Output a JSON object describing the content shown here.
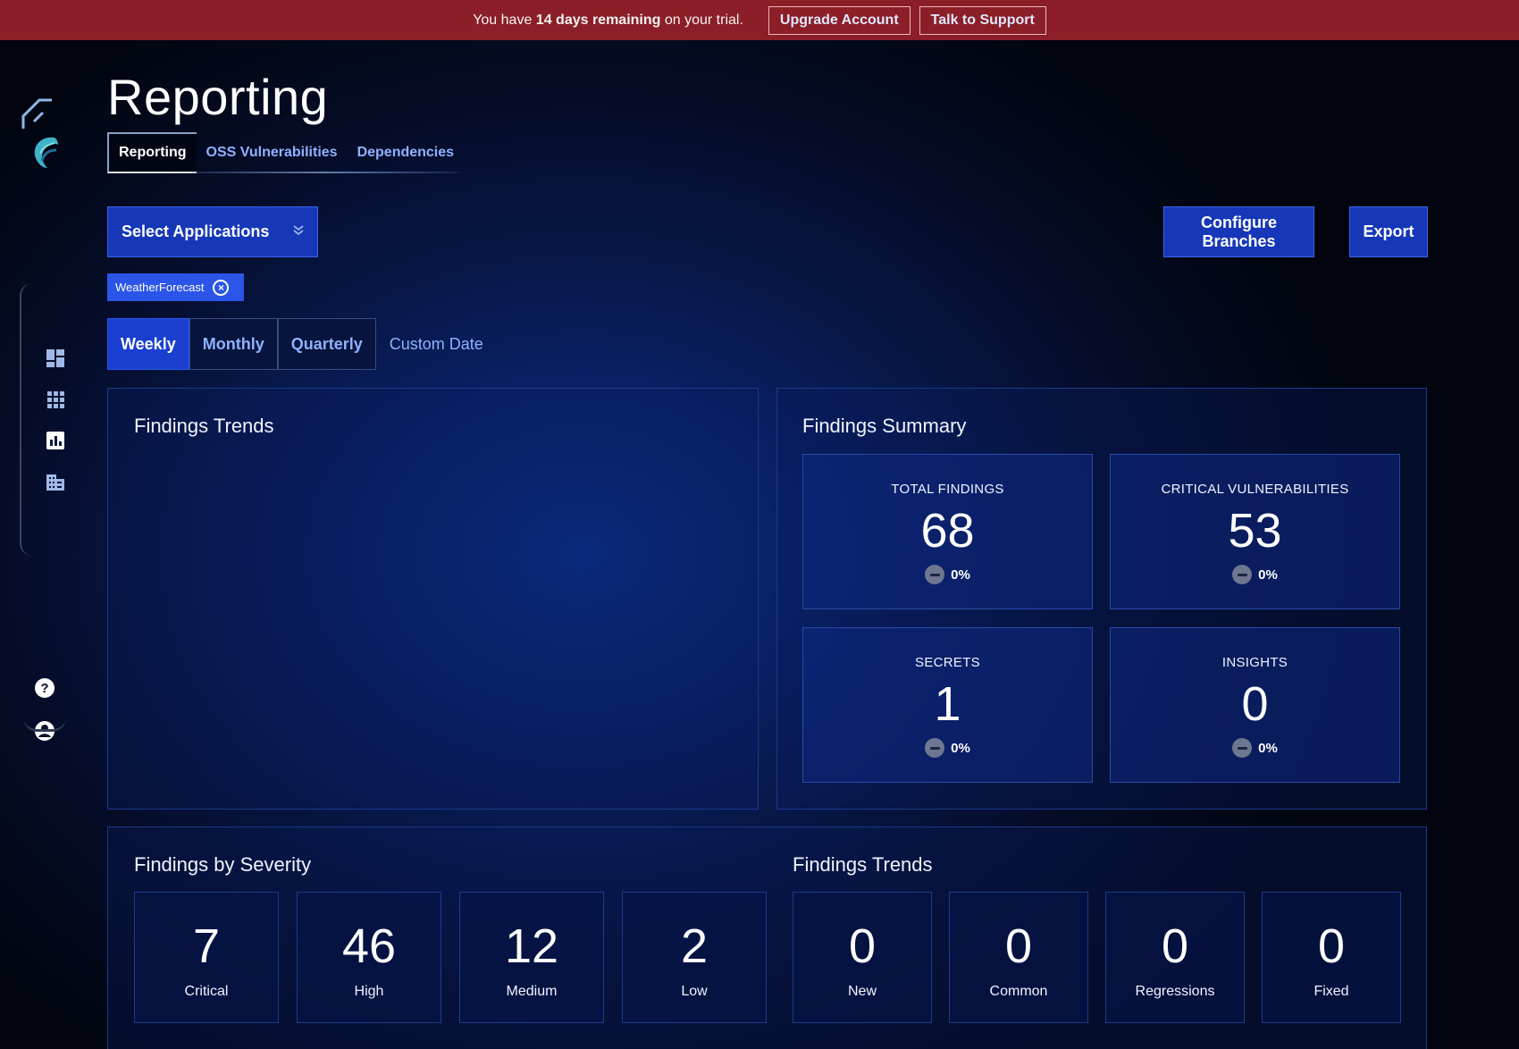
{
  "banner": {
    "prefix": "You have ",
    "highlight": "14 days remaining",
    "suffix": " on your trial.",
    "upgrade_label": "Upgrade Account",
    "support_label": "Talk to Support"
  },
  "sidebar": {
    "icons": [
      "back-arrow-icon",
      "logo-icon",
      "dashboard-icon",
      "apps-grid-icon",
      "chart-icon",
      "building-icon",
      "help-icon",
      "user-icon"
    ]
  },
  "page": {
    "title": "Reporting",
    "tabs": [
      {
        "label": "Reporting",
        "active": true
      },
      {
        "label": "OSS Vulnerabilities",
        "active": false
      },
      {
        "label": "Dependencies",
        "active": false
      }
    ]
  },
  "toolbar": {
    "select_label": "Select Applications",
    "configure_label": "Configure Branches",
    "export_label": "Export"
  },
  "filter_chip": {
    "label": "WeatherForecast"
  },
  "period": {
    "options": [
      {
        "label": "Weekly",
        "active": true
      },
      {
        "label": "Monthly",
        "active": false
      },
      {
        "label": "Quarterly",
        "active": false
      },
      {
        "label": "Custom Date",
        "active": false
      }
    ]
  },
  "findings_trends_panel": {
    "title": "Findings Trends"
  },
  "findings_summary": {
    "title": "Findings Summary",
    "cards": [
      {
        "label": "TOTAL FINDINGS",
        "value": "68",
        "delta": "0%"
      },
      {
        "label": "CRITICAL VULNERABILITIES",
        "value": "53",
        "delta": "0%"
      },
      {
        "label": "SECRETS",
        "value": "1",
        "delta": "0%"
      },
      {
        "label": "INSIGHTS",
        "value": "0",
        "delta": "0%"
      }
    ]
  },
  "severity": {
    "title": "Findings by Severity",
    "items": [
      {
        "value": "7",
        "label": "Critical"
      },
      {
        "value": "46",
        "label": "High"
      },
      {
        "value": "12",
        "label": "Medium"
      },
      {
        "value": "2",
        "label": "Low"
      }
    ]
  },
  "trends": {
    "title": "Findings Trends",
    "items": [
      {
        "value": "0",
        "label": "New"
      },
      {
        "value": "0",
        "label": "Common"
      },
      {
        "value": "0",
        "label": "Regressions"
      },
      {
        "value": "0",
        "label": "Fixed"
      }
    ]
  },
  "colors": {
    "banner": "#8b1e26",
    "primary_button": "#1537b8",
    "chip": "#2a55e8",
    "link": "#8fb2ff"
  }
}
